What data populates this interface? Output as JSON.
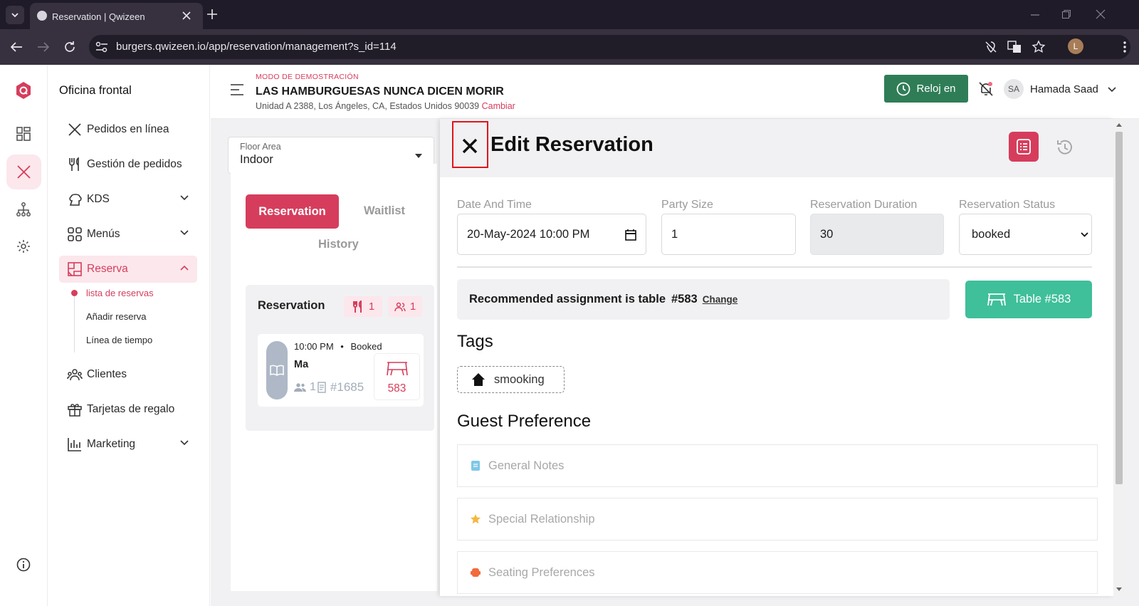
{
  "browser": {
    "tab_title": "Reservation | Qwizeen",
    "url": "burgers.qwizeen.io/app/reservation/management?s_id=114",
    "profile_initial": "L"
  },
  "sidebar": {
    "section_title": "Oficina frontal",
    "items": [
      {
        "label": "Pedidos en línea",
        "icon": "fork-knife-icon"
      },
      {
        "label": "Gestión de pedidos",
        "icon": "utensils-icon"
      },
      {
        "label": "KDS",
        "icon": "chef-hat-icon"
      },
      {
        "label": "Menús",
        "icon": "grid-icon"
      },
      {
        "label": "Reserva",
        "icon": "floorplan-icon"
      },
      {
        "label": "Clientes",
        "icon": "users-icon"
      },
      {
        "label": "Tarjetas de regalo",
        "icon": "gift-icon"
      },
      {
        "label": "Marketing",
        "icon": "bar-chart-icon"
      }
    ],
    "subitems": [
      "lista de reservas",
      "Añadir reserva",
      "Línea de tiempo"
    ]
  },
  "header": {
    "demo_mode": "MODO DE DEMOSTRACIÓN",
    "restaurant_name": "LAS HAMBURGUESAS NUNCA DICEN MORIR",
    "address": "Unidad A 2388, Los Ángeles, CA, Estados Unidos 90039",
    "change_link": "Cambiar",
    "clock_button": "Reloj en",
    "user_initials": "SA",
    "user_name": "Hamada Saad"
  },
  "reservations": {
    "floor_area_label": "Floor Area",
    "floor_area_value": "Indoor",
    "tabs": [
      "Reservation",
      "Waitlist",
      "History"
    ],
    "list_title": "Reservation",
    "count_tables": "1",
    "count_guests": "1",
    "card": {
      "time": "10:00 PM",
      "status": "Booked",
      "name": "Ma",
      "party": "1",
      "order_number": "#1685",
      "table": "583"
    }
  },
  "edit_panel": {
    "title": "Edit Reservation",
    "date_label": "Date And Time",
    "date_value": "20-May-2024 10:00  PM",
    "party_label": "Party Size",
    "party_value": "1",
    "duration_label": "Reservation Duration",
    "duration_value": "30",
    "status_label": "Reservation Status",
    "status_value": "booked",
    "recommend_text": "Recommended assignment is table",
    "recommend_table": "#583",
    "change_link": "Change",
    "table_button": "Table #583",
    "tags_title": "Tags",
    "tag": "smooking",
    "guest_pref_title": "Guest Preference",
    "preferences": [
      "General Notes",
      "Special Relationship",
      "Seating Preferences"
    ]
  },
  "colors": {
    "brand": "#d63d5c",
    "accent_green": "#2f7d57",
    "teal": "#3fbf9a",
    "highlight_box": "#e0161b"
  }
}
